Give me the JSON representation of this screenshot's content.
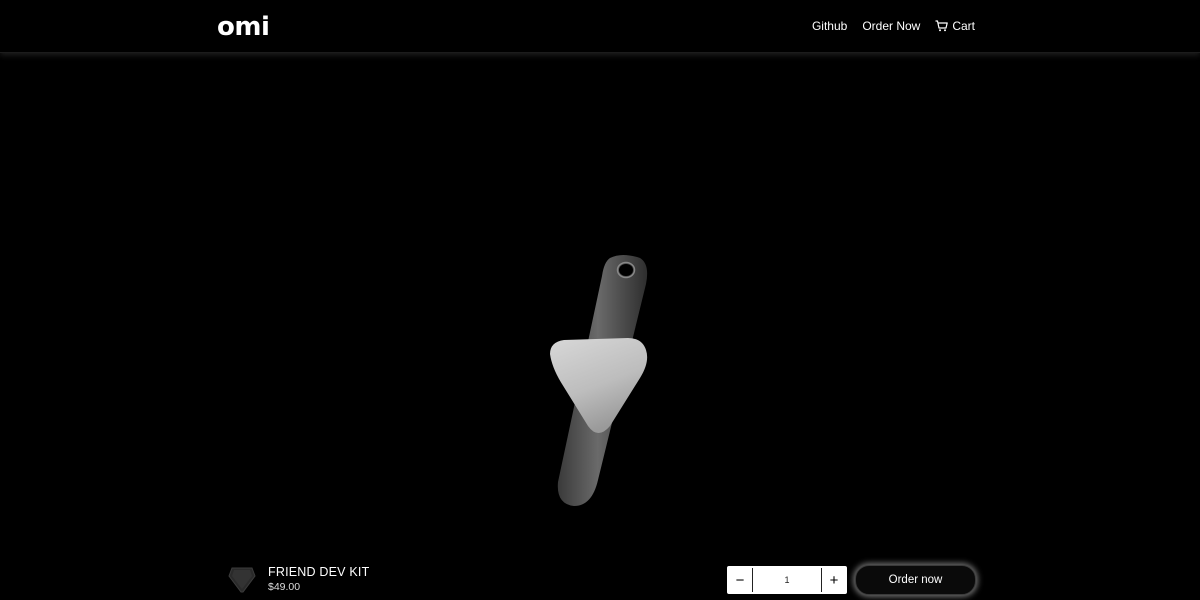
{
  "header": {
    "logo": "omi",
    "nav": {
      "github": "Github",
      "order_now": "Order Now",
      "cart": "Cart"
    }
  },
  "hero": {
    "image_subject": "omi-device"
  },
  "product": {
    "name": "FRIEND DEV KIT",
    "price": "$49.00",
    "quantity": "1",
    "decrement_symbol": "−",
    "increment_symbol": "+",
    "order_button": "Order now"
  },
  "colors": {
    "background": "#000000",
    "text": "#ffffff",
    "button_glow": "#c8c8c8"
  },
  "icons": [
    "cart-icon",
    "minus-icon",
    "plus-icon"
  ]
}
